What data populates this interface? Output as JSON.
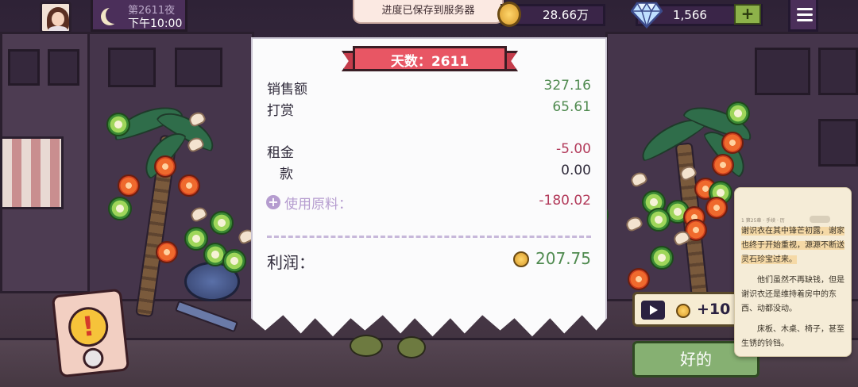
{
  "header": {
    "night_label": "第2611夜",
    "time_label": "下午10:00",
    "save_toast": "进度已保存到服务器",
    "coins": "28.66万",
    "gems": "1,566",
    "add_label": "+"
  },
  "receipt": {
    "day_banner": "天数：2611",
    "rows": [
      {
        "label": "销售额",
        "value": "327.16"
      },
      {
        "label": "打赏",
        "value": "65.61"
      },
      {
        "label": "租金",
        "value": "-5.00"
      },
      {
        "label": "款",
        "value": "0.00"
      }
    ],
    "material_icon": "+",
    "material_label": "使用原料：",
    "material_value": "-180.02",
    "profit_label": "利润：",
    "profit_value": "207.75"
  },
  "actions": {
    "ad_reward": "+10",
    "ok_label": "好的",
    "alert_mark": "!"
  },
  "reader": {
    "bar_text": "1 第25章 · 手续 · 历",
    "pill_text": "",
    "p1_hl": "谢识衣在其中锋芒初露，谢家也终于开始重视，源源不断送灵石珍宝过来。",
    "p2": "他们虽然不再缺钱，但是谢识衣还是维持着房中的东西、动都没动。",
    "p3": "床板、木桌、椅子，甚至生锈的铃铛。"
  },
  "colors": {
    "profit_green": "#4f8a4f",
    "expense_red": "#b23a5a",
    "banner_red": "#e85664",
    "ok_green": "#86b072"
  }
}
